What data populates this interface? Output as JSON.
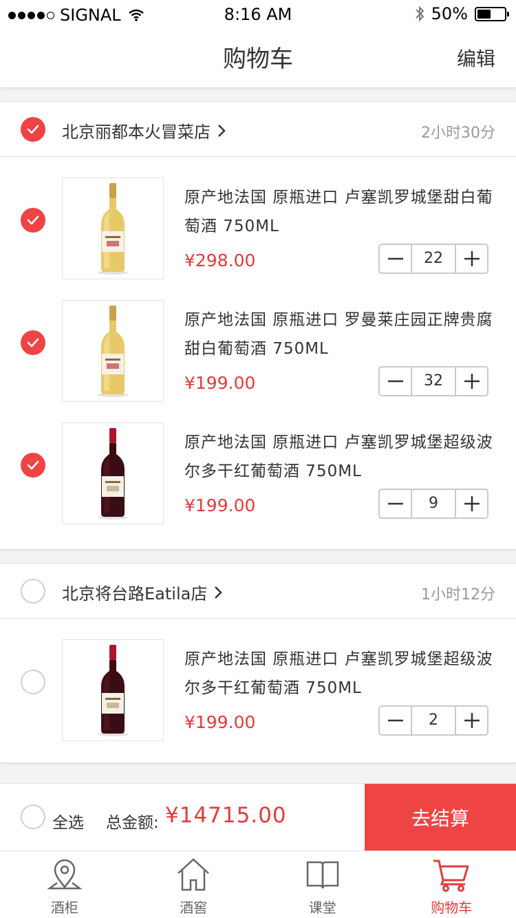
{
  "status_bar": {
    "carrier": "SIGNAL",
    "time": "8:16 AM",
    "battery": "50%",
    "battery_level": 0.5
  },
  "nav": {
    "title": "购物车",
    "edit_label": "编辑"
  },
  "stores": [
    {
      "name": "北京丽都本火冒菜店",
      "time": "2小时30分",
      "checked": true,
      "items": [
        {
          "title": "原产地法国  原瓶进口  卢塞凯罗城堡甜白葡萄酒  750ML",
          "price": "¥298.00",
          "qty": "22",
          "checked": true,
          "wine": "white"
        },
        {
          "title": "原产地法国  原瓶进口  罗曼莱庄园正牌贵腐甜白葡萄酒   750ML",
          "price": "¥199.00",
          "qty": "32",
          "checked": true,
          "wine": "white"
        },
        {
          "title": "原产地法国  原瓶进口  卢塞凯罗城堡超级波尔多干红葡萄酒   750ML",
          "price": "¥199.00",
          "qty": "9",
          "checked": true,
          "wine": "red"
        }
      ]
    },
    {
      "name": "北京将台路Eatila店",
      "time": "1小时12分",
      "checked": false,
      "items": [
        {
          "title": "原产地法国  原瓶进口  卢塞凯罗城堡超级波尔多干红葡萄酒   750ML",
          "price": "¥199.00",
          "qty": "2",
          "checked": false,
          "wine": "red"
        }
      ]
    }
  ],
  "summary": {
    "select_all": "全选",
    "total_label": "总金额:",
    "total_value": "¥14715.00",
    "checkout": "去结算"
  },
  "tabs": [
    {
      "label": "酒柜",
      "icon": "location-pin-icon"
    },
    {
      "label": "酒窖",
      "icon": "house-icon"
    },
    {
      "label": "课堂",
      "icon": "book-icon"
    },
    {
      "label": "购物车",
      "icon": "cart-icon",
      "active": true
    }
  ],
  "colors": {
    "accent": "#ee4444",
    "price": "#e63a3a",
    "muted": "#999999"
  }
}
